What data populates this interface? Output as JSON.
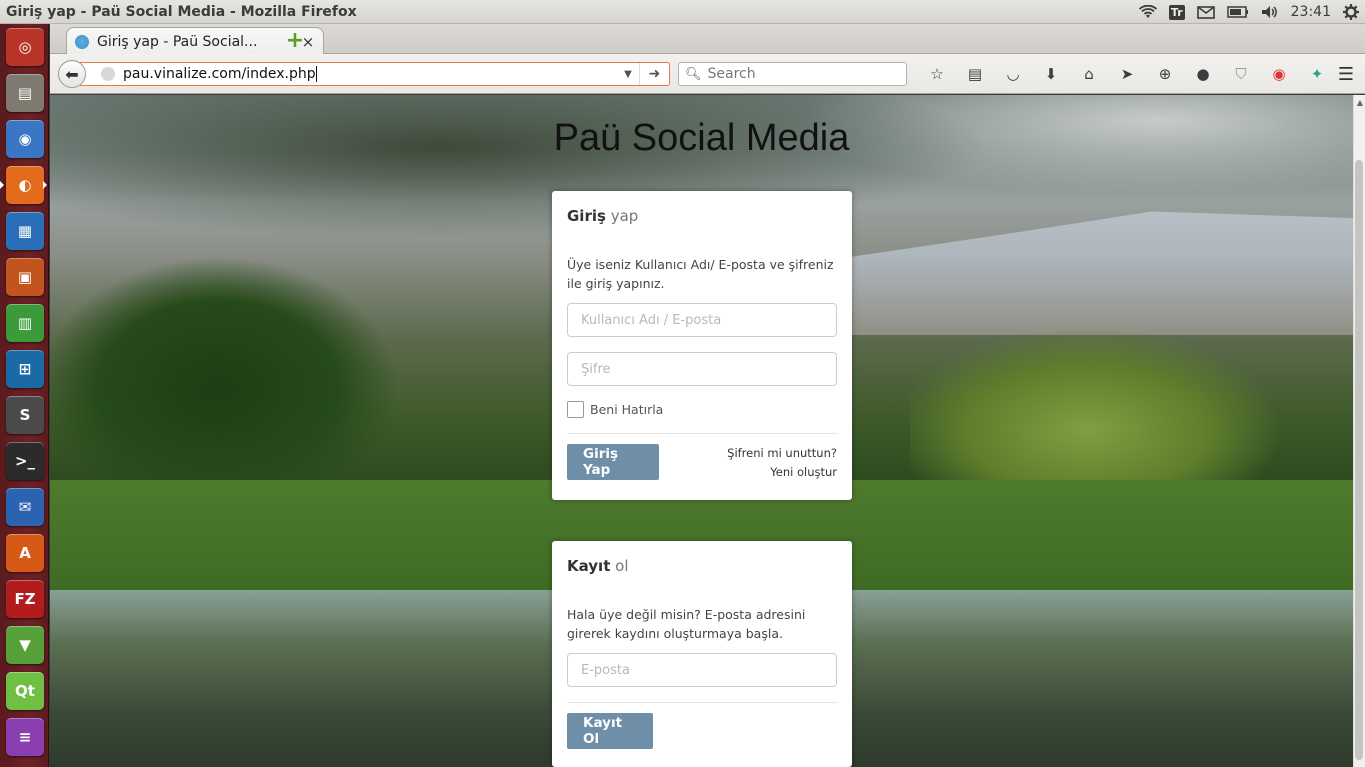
{
  "window": {
    "title": "Giriş yap - Paü Social Media - Mozilla Firefox"
  },
  "indicators": {
    "keyboard": "Tr",
    "time": "23:41"
  },
  "launcher": {
    "items": [
      {
        "name": "dash-home",
        "color": "#b9352a",
        "glyph": "◎"
      },
      {
        "name": "files",
        "color": "#7f7a70",
        "glyph": "▤"
      },
      {
        "name": "chromium",
        "color": "#3b76c5",
        "glyph": "◉"
      },
      {
        "name": "firefox",
        "color": "#e46b1e",
        "glyph": "◐"
      },
      {
        "name": "libreoffice-writer",
        "color": "#2a6fb8",
        "glyph": "▦"
      },
      {
        "name": "libreoffice-impress",
        "color": "#c2541e",
        "glyph": "▣"
      },
      {
        "name": "libreoffice-calc",
        "color": "#3b9a3a",
        "glyph": "▥"
      },
      {
        "name": "app-blue",
        "color": "#1b6aa5",
        "glyph": "⊞"
      },
      {
        "name": "sublime-text",
        "color": "#4a4a4a",
        "glyph": "S"
      },
      {
        "name": "terminal",
        "color": "#2b2b2b",
        "glyph": ">_"
      },
      {
        "name": "thunderbird",
        "color": "#2b63b0",
        "glyph": "✉"
      },
      {
        "name": "software-center",
        "color": "#d65a16",
        "glyph": "A"
      },
      {
        "name": "filezilla",
        "color": "#b11c1c",
        "glyph": "FZ"
      },
      {
        "name": "app-green",
        "color": "#58a03a",
        "glyph": "▼"
      },
      {
        "name": "qt-creator",
        "color": "#6fbf45",
        "glyph": "Qt"
      },
      {
        "name": "app-stack",
        "color": "#8a3fb0",
        "glyph": "≡"
      }
    ]
  },
  "tab": {
    "title": "Giriş yap - Paü Social...",
    "close": "×",
    "new_tab": "+"
  },
  "nav": {
    "url": "pau.vinalize.com/index.php",
    "search_placeholder": "Search"
  },
  "page": {
    "brand": "Paü Social Media",
    "login": {
      "title_bold": "Giriş",
      "title_light": "yap",
      "description": "Üye iseniz Kullanıcı Adı/ E-posta ve şifreniz ile giriş yapınız.",
      "username_placeholder": "Kullanıcı Adı / E-posta",
      "password_placeholder": "Şifre",
      "remember_label": "Beni Hatırla",
      "submit_label": "Giriş Yap",
      "forgot_label": "Şifreni mi unuttun?",
      "create_label": "Yeni oluştur"
    },
    "register": {
      "title_bold": "Kayıt",
      "title_light": "ol",
      "description": "Hala üye değil misin? E-posta adresini girerek kaydını oluşturmaya başla.",
      "email_placeholder": "E-posta",
      "submit_label": "Kayıt Ol"
    }
  },
  "colors": {
    "button": "#6f8ea8",
    "launcher": "#6e2226"
  }
}
